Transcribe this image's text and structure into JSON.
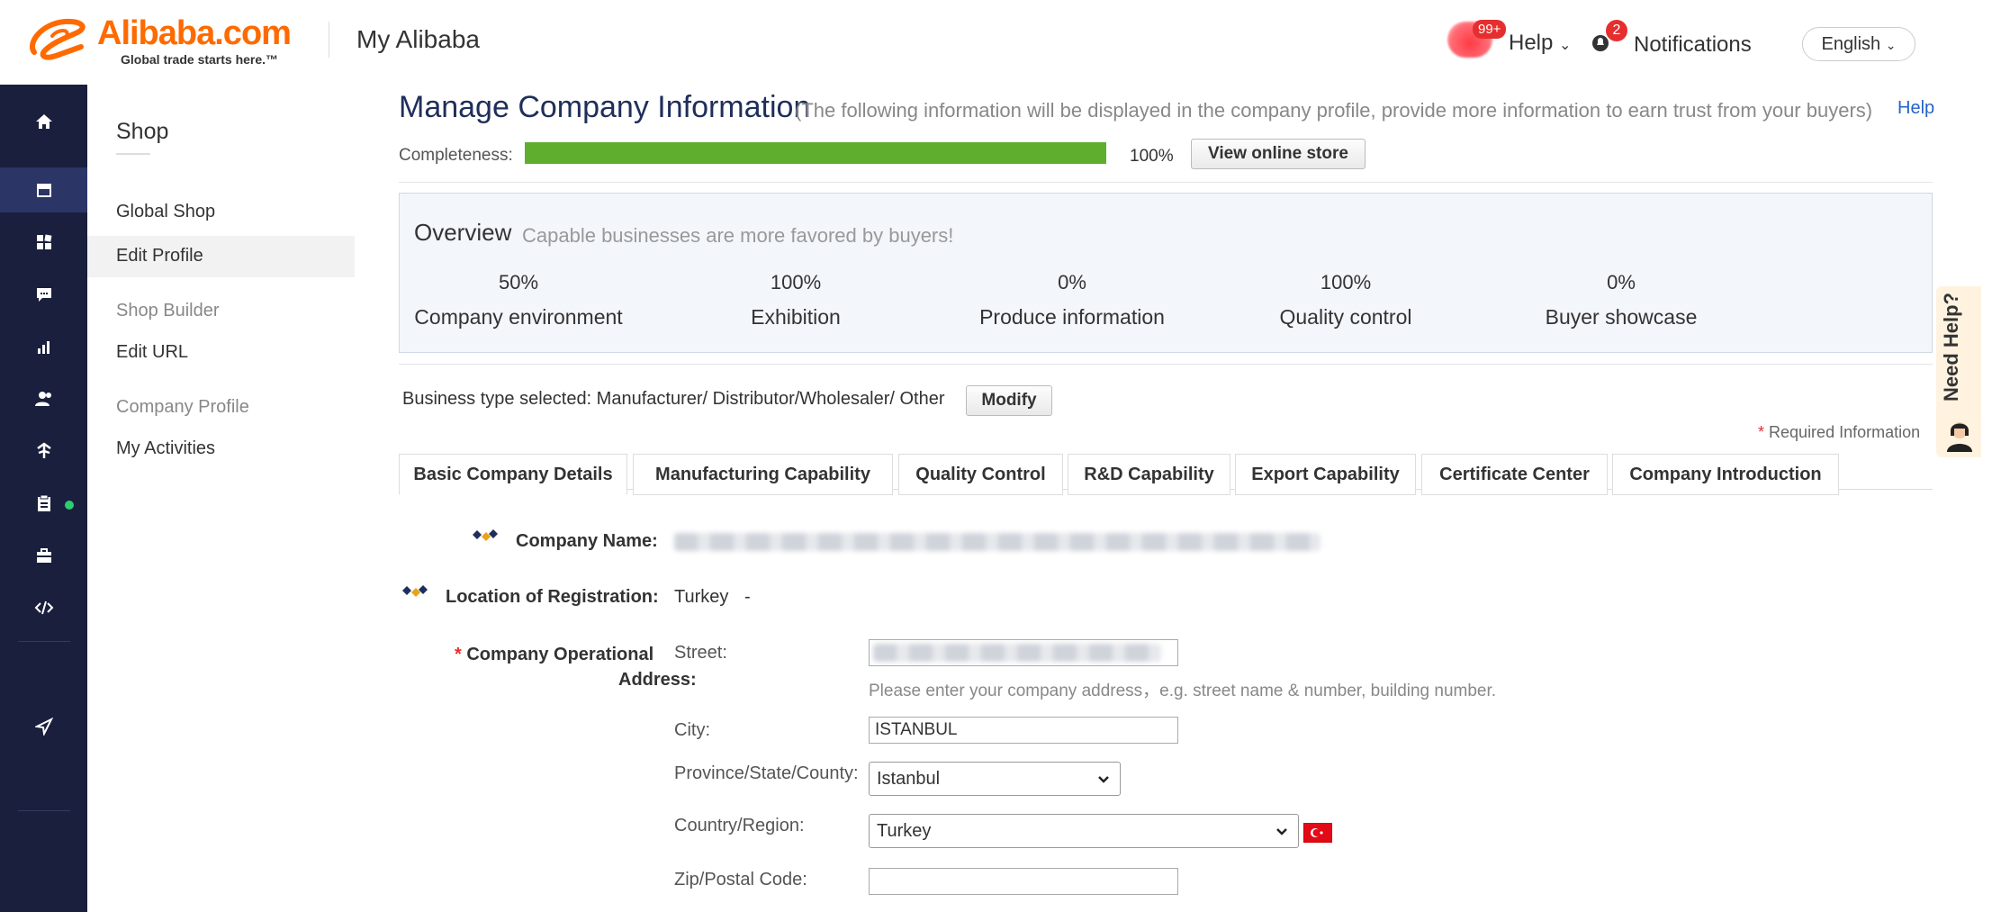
{
  "header": {
    "logo_text": "Alibaba.com",
    "logo_tagline": "Global trade starts here.™",
    "title": "My Alibaba",
    "help_badge": "99+",
    "help_label": "Help",
    "notifications_count": "2",
    "notifications_label": "Notifications",
    "language": "English"
  },
  "rail": {
    "icons": [
      "home-icon",
      "store-icon",
      "dashboard-icon",
      "message-icon",
      "analytics-icon",
      "users-icon",
      "logistics-icon",
      "clipboard-icon",
      "briefcase-icon",
      "code-icon",
      "send-icon"
    ]
  },
  "submenu": {
    "title": "Shop",
    "items": [
      "Global Shop",
      "Edit Profile",
      "Shop Builder",
      "Edit URL",
      "Company Profile",
      "My Activities"
    ]
  },
  "main": {
    "title": "Manage Company Information",
    "subtitle": "(The following information will be displayed in the company profile, provide more information to earn trust from your buyers)",
    "help_link": "Help",
    "completeness_label": "Completeness:",
    "completeness_percent": "100%",
    "completeness_value": 100,
    "view_store_label": "View online store",
    "overview": {
      "title": "Overview",
      "subtitle": "Capable businesses are more favored by buyers!",
      "metrics": [
        {
          "percent": "50%",
          "label": "Company environment"
        },
        {
          "percent": "100%",
          "label": "Exhibition"
        },
        {
          "percent": "0%",
          "label": "Produce information"
        },
        {
          "percent": "100%",
          "label": "Quality control"
        },
        {
          "percent": "0%",
          "label": "Buyer showcase"
        }
      ]
    },
    "business_type_text": "Business type selected: Manufacturer/ Distributor/Wholesaler/ Other",
    "modify_label": "Modify",
    "required_info": "Required Information",
    "tabs": [
      "Basic Company Details",
      "Manufacturing Capability",
      "Quality Control",
      "R&D Capability",
      "Export Capability",
      "Certificate Center",
      "Company Introduction"
    ],
    "form": {
      "company_name_label": "Company Name:",
      "location_label": "Location of Registration:",
      "location_value": "Turkey",
      "location_dash": "-",
      "operational_address_label_1": "Company Operational",
      "operational_address_label_2": "Address:",
      "street_label": "Street:",
      "street_hint": "Please enter your company address，e.g. street name & number, building number.",
      "city_label": "City:",
      "city_value": "ISTANBUL",
      "province_label": "Province/State/County:",
      "province_value": "Istanbul",
      "country_label": "Country/Region:",
      "country_value": "Turkey",
      "zip_label": "Zip/Postal Code:",
      "zip_value": ""
    }
  },
  "need_help": "Need Help?",
  "colors": {
    "brand_orange": "#ff6a00",
    "progress_green": "#5fae2e",
    "rail_bg": "#1a1f3d",
    "title_navy": "#1f2e5a",
    "required_red": "#e62e2e"
  }
}
